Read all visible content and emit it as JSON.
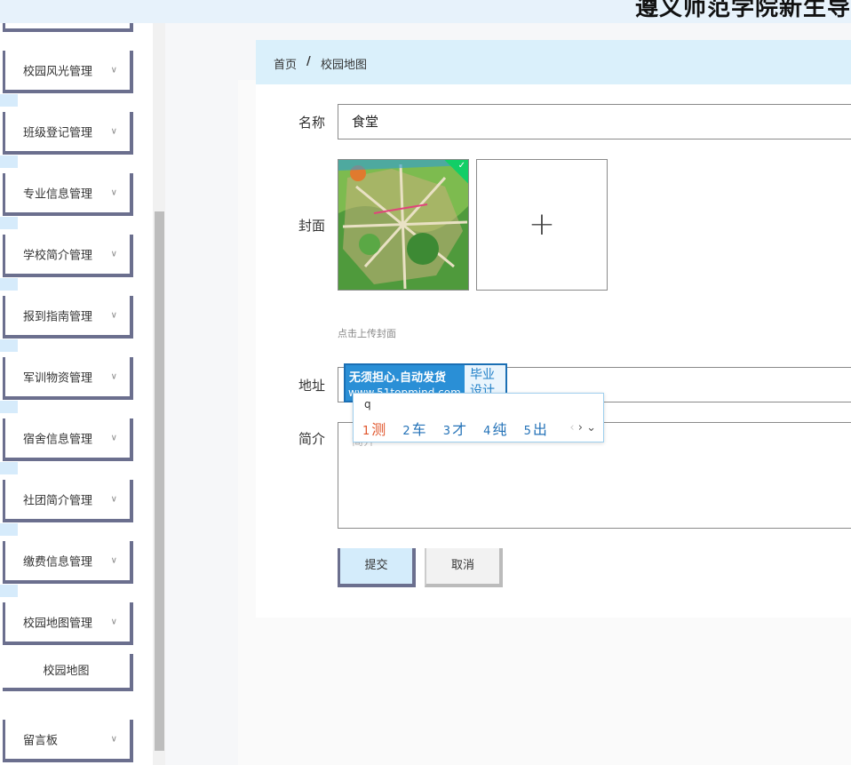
{
  "header": {
    "title": "遵义师范学院新生导"
  },
  "sidebar": {
    "items": [
      {
        "label": "校园风光管理"
      },
      {
        "label": "班级登记管理"
      },
      {
        "label": "专业信息管理"
      },
      {
        "label": "学校简介管理"
      },
      {
        "label": "报到指南管理"
      },
      {
        "label": "军训物资管理"
      },
      {
        "label": "宿舍信息管理"
      },
      {
        "label": "社团简介管理"
      },
      {
        "label": "缴费信息管理"
      },
      {
        "label": "校园地图管理"
      }
    ],
    "subitem": {
      "label": "校园地图"
    },
    "last_item": {
      "label": "留言板"
    }
  },
  "breadcrumb": {
    "home": "首页",
    "separator": "/",
    "current": "校园地图"
  },
  "form": {
    "name_label": "名称",
    "name_value": "食堂",
    "cover_label": "封面",
    "cover_hint": "点击上传封面",
    "upload_plus": "+",
    "address_label": "地址",
    "intro_label": "简介",
    "intro_placeholder": "简介",
    "submit": "提交",
    "cancel": "取消"
  },
  "watermark": {
    "line1": "无须担心.自动发货",
    "line2": "www.51topmind.com",
    "badge_line1": "毕业",
    "badge_line2": "设计"
  },
  "ime": {
    "composition": "q",
    "candidates": [
      {
        "n": "1",
        "text": "测"
      },
      {
        "n": "2",
        "text": "车"
      },
      {
        "n": "3",
        "text": "才"
      },
      {
        "n": "4",
        "text": "纯"
      },
      {
        "n": "5",
        "text": "出"
      }
    ]
  },
  "icons": {
    "chevron": "chevron-down-icon",
    "check": "check-icon",
    "plus": "plus-icon"
  },
  "colors": {
    "sidebar_border": "#6b6f8e",
    "breadcrumb_bg": "#daf0fb",
    "submit_bg": "#d4ecfb",
    "watermark_bg": "#2a8fd6"
  }
}
